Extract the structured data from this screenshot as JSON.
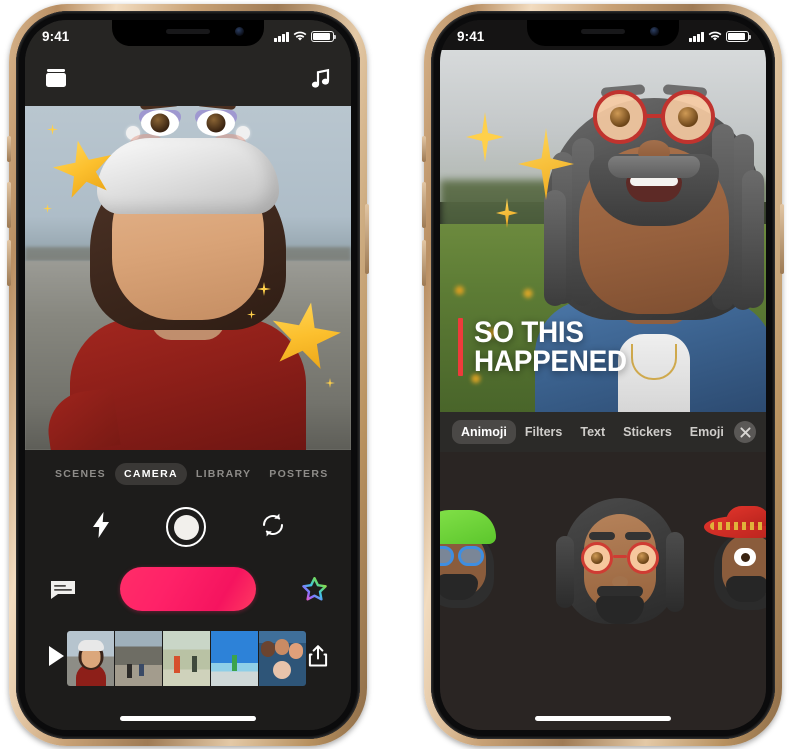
{
  "device": {
    "frame_color": "#c9a276",
    "status": {
      "time": "9:41",
      "signal_icon": "cellular-bars-icon",
      "wifi_icon": "wifi-icon",
      "battery_icon": "battery-icon"
    },
    "home_indicator": "home-indicator"
  },
  "left_phone": {
    "toolbar": {
      "projects_icon": "projects-folder-icon",
      "music_icon": "music-note-icon"
    },
    "preview": {
      "scene_description": "beach",
      "memoji": "memoji-beret-woman",
      "stickers": [
        "star-sticker",
        "star-sticker",
        "sparkle-dot",
        "sparkle-dot",
        "sparkle-dot"
      ]
    },
    "tabs": [
      {
        "label": "SCENES",
        "active": false
      },
      {
        "label": "CAMERA",
        "active": true
      },
      {
        "label": "LIBRARY",
        "active": false
      },
      {
        "label": "POSTERS",
        "active": false
      }
    ],
    "camera_controls": {
      "flash_icon": "flash-bolt-icon",
      "photo_icon": "shutter-circle-icon",
      "flip_icon": "camera-flip-icon"
    },
    "record_row": {
      "captions_icon": "captions-bubble-icon",
      "record_button": "record-button",
      "record_color": "#ff2363",
      "effects_icon": "rainbow-star-icon"
    },
    "timeline": {
      "play_icon": "play-icon",
      "share_icon": "share-icon",
      "clips": [
        {
          "name": "clip-memoji-beach"
        },
        {
          "name": "clip-beach-walkers"
        },
        {
          "name": "clip-dune-kite"
        },
        {
          "name": "clip-beach-jump"
        },
        {
          "name": "clip-group-selfie"
        }
      ]
    }
  },
  "right_phone": {
    "preview": {
      "scene_description": "flower field",
      "memoji": "memoji-dreadlocks-glasses",
      "title_line_1": "SO THIS",
      "title_line_2": "HAPPENED",
      "title_accent_color": "#ef3b3b",
      "stickers": [
        "sparkle-large",
        "sparkle-medium",
        "sparkle-small"
      ]
    },
    "effects_tabs": [
      {
        "label": "Animoji",
        "active": true
      },
      {
        "label": "Filters",
        "active": false
      },
      {
        "label": "Text",
        "active": false
      },
      {
        "label": "Stickers",
        "active": false
      },
      {
        "label": "Emoji",
        "active": false
      }
    ],
    "close_icon": "close-x-icon",
    "animoji_options": [
      {
        "name": "animoji-green-beanie"
      },
      {
        "name": "animoji-dreadlocks-red-glasses"
      },
      {
        "name": "animoji-red-sombrero"
      }
    ]
  }
}
